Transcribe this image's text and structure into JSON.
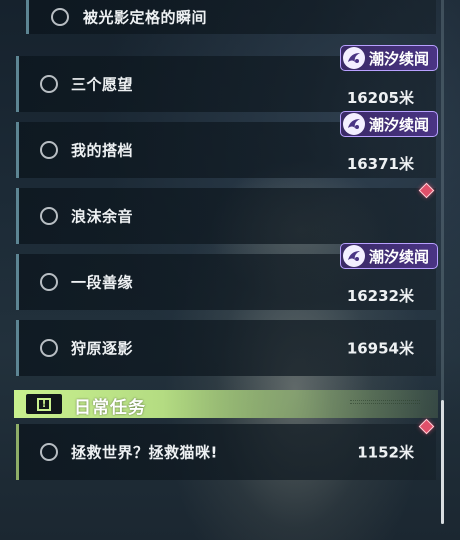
{
  "quests": [
    {
      "name": "被光影定格的瞬间",
      "distance": "",
      "badge": false,
      "marker": false
    },
    {
      "name": "三个愿望",
      "distance": "16205米",
      "badge": true,
      "marker": false
    },
    {
      "name": "我的搭档",
      "distance": "16371米",
      "badge": true,
      "marker": false
    },
    {
      "name": "浪沫余音",
      "distance": "",
      "badge": false,
      "marker": true
    },
    {
      "name": "一段善缘",
      "distance": "16232米",
      "badge": true,
      "marker": false
    },
    {
      "name": "狩原逐影",
      "distance": "16954米",
      "badge": false,
      "marker": false
    }
  ],
  "badge": {
    "label": "潮汐续闻",
    "color": "#4a3484",
    "icon": "tide-emblem-icon"
  },
  "daily_section": {
    "title": "日常任务",
    "icon": "exclamation-icon",
    "accent": "#c9f08e",
    "quests": [
      {
        "name": "拯救世界？拯救猫咪!",
        "distance": "1152米",
        "marker": true
      }
    ]
  },
  "colors": {
    "marker": "#e0506a",
    "row_border": "#5d8593",
    "daily_border": "#8fae68"
  },
  "scrollbar": {
    "position": "bottom"
  }
}
